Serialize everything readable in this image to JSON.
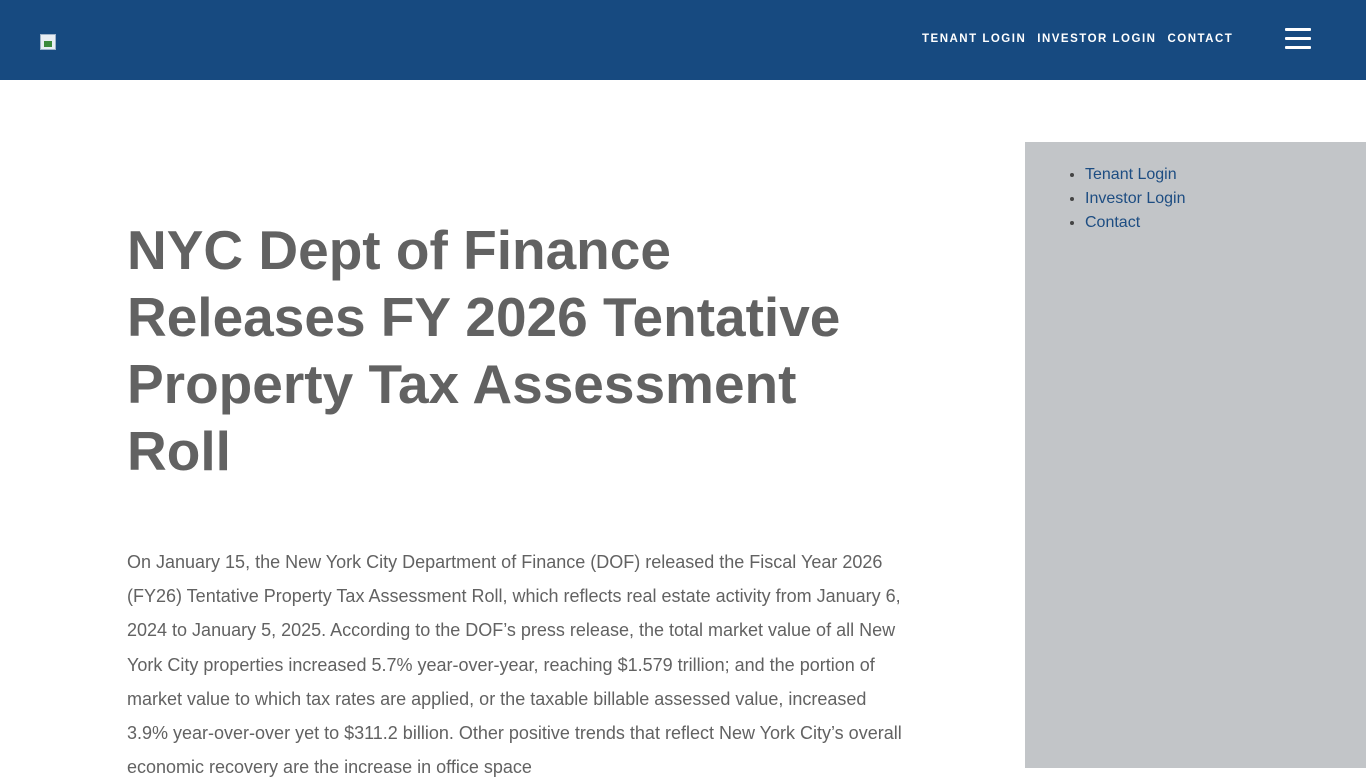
{
  "header": {
    "nav": [
      "TENANT LOGIN",
      "INVESTOR LOGIN",
      "CONTACT"
    ],
    "menu_icon": "hamburger-icon",
    "logo_icon": "broken-image-icon",
    "background_color": "#174a80"
  },
  "article": {
    "title": "NYC Dept of Finance Releases FY 2026 Tentative Property Tax Assessment Roll",
    "body": "On January 15, the New York City Department of Finance (DOF) released the Fiscal Year 2026 (FY26) Tentative Property Tax Assessment Roll, which reflects real estate activity from January 6, 2024 to January 5, 2025. According to the DOF’s press release, the total market value of all New York City properties increased 5.7% year-over-year, reaching $1.579 trillion; and the portion of market value to which tax rates are applied, or the taxable billable assessed value, increased 3.9% year-over-over yet to $311.2 billion. Other positive trends that reflect New York City’s overall economic recovery are the increase in office space"
  },
  "sidebar": {
    "links": [
      "Tenant Login",
      "Investor Login",
      "Contact"
    ],
    "background_color": "#c2c5c8"
  }
}
